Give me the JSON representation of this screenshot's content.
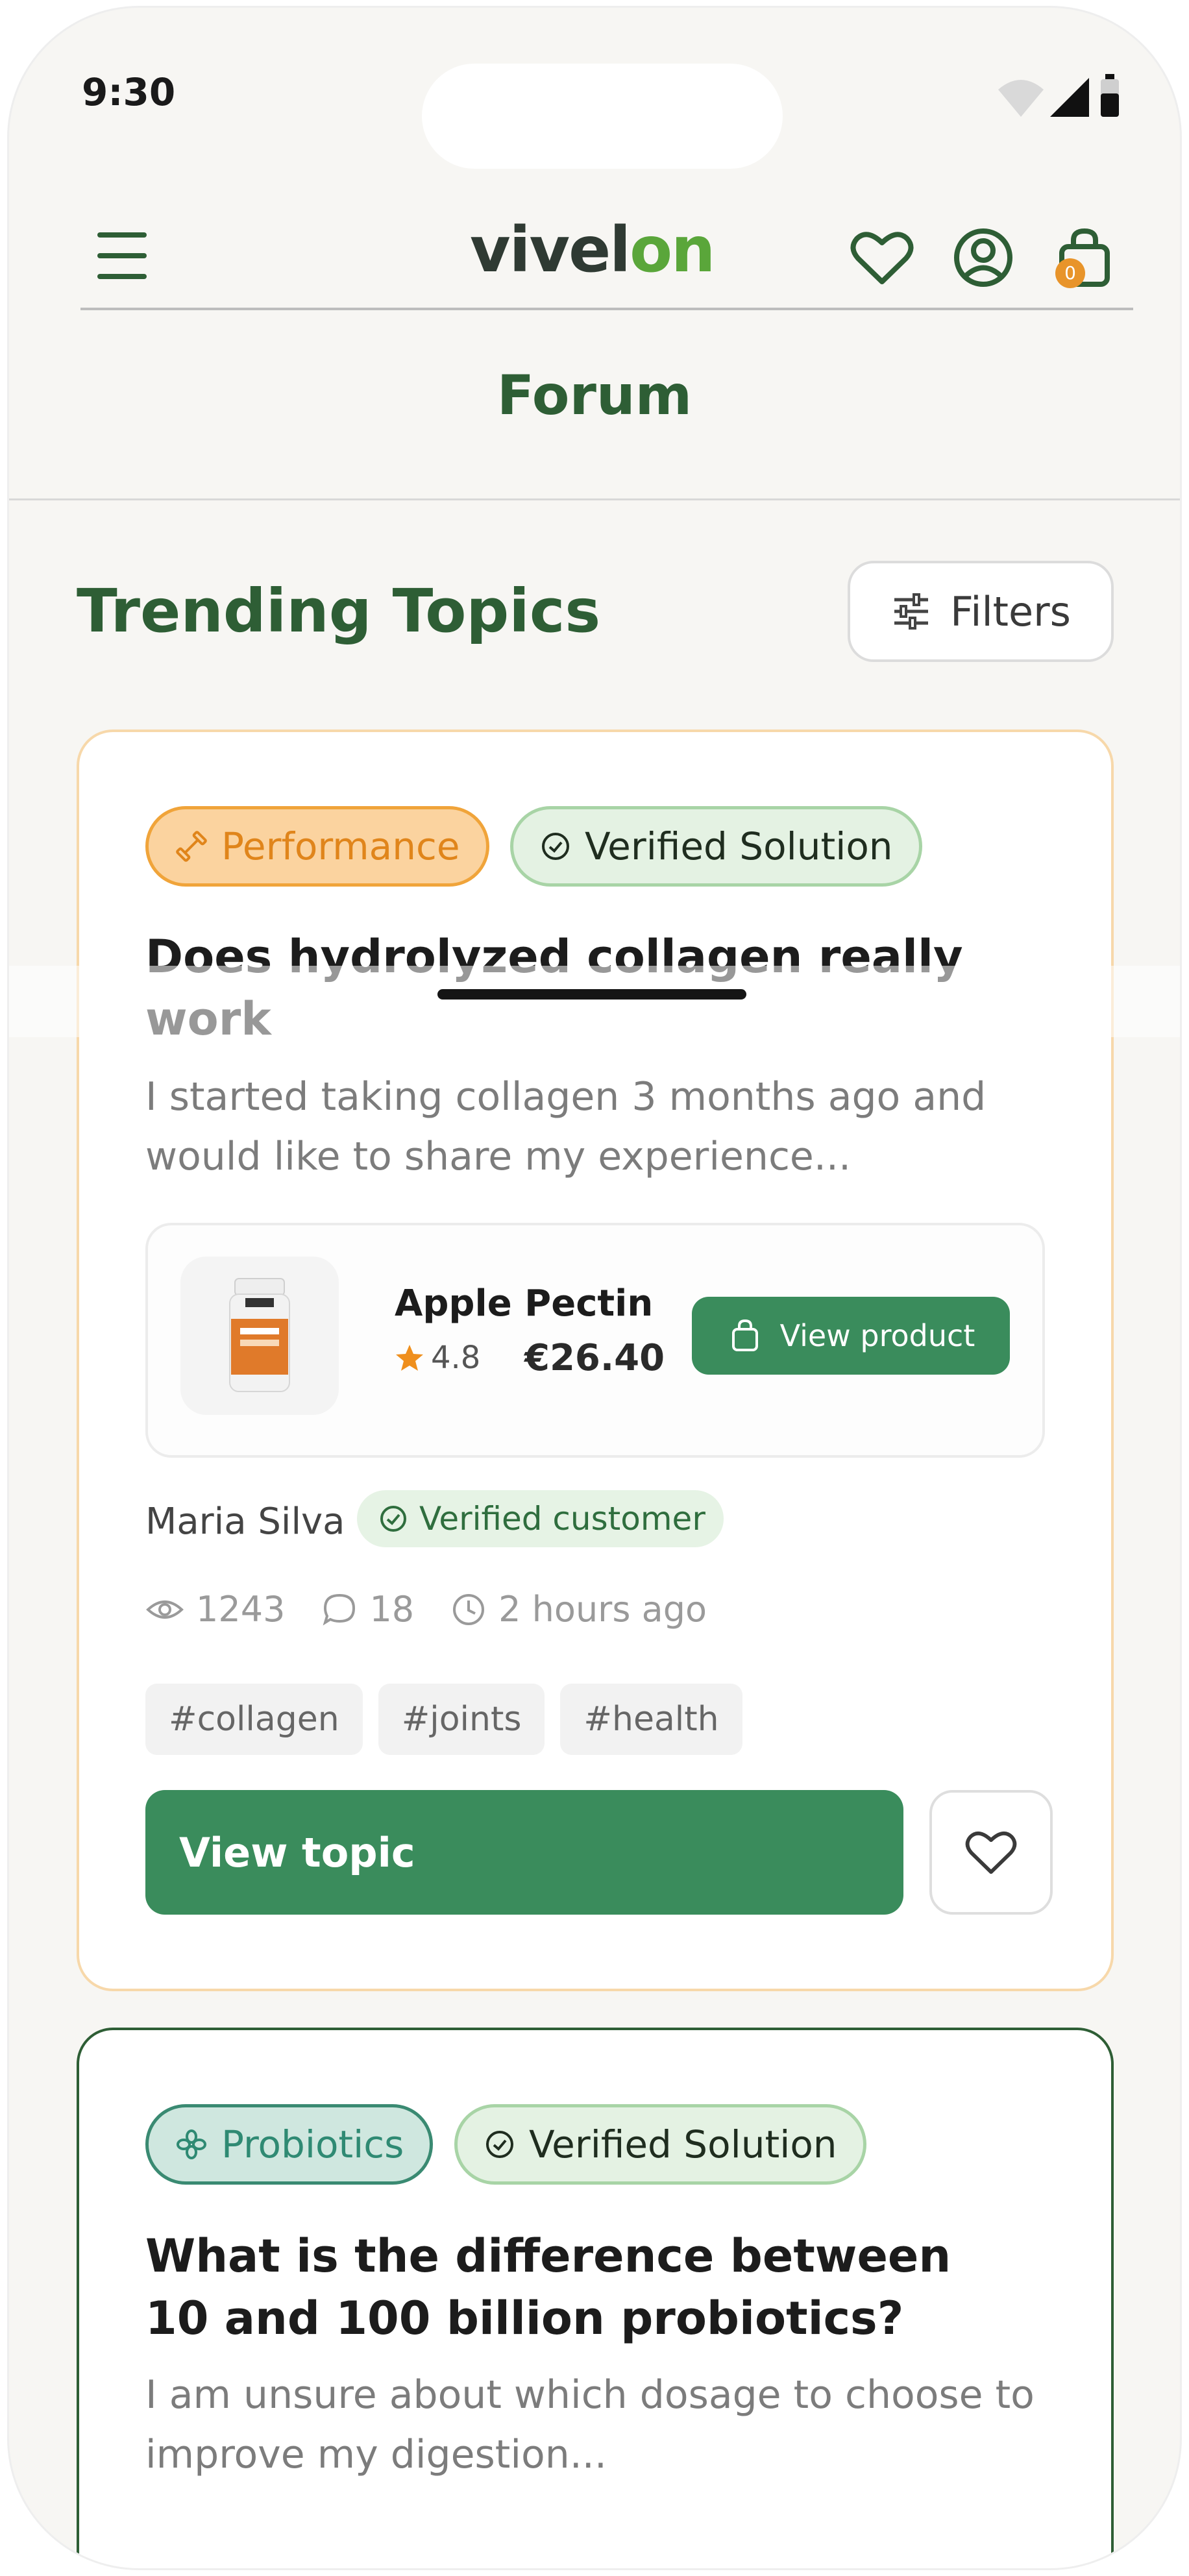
{
  "status_bar": {
    "time": "9:30"
  },
  "header": {
    "logo_text": "vivel",
    "logo_leaf": "o",
    "logo_end": "n",
    "cart_count": "0",
    "icons": [
      "menu-icon",
      "heart-icon",
      "user-icon",
      "cart-icon"
    ]
  },
  "page": {
    "title": "Forum"
  },
  "section": {
    "title": "Trending Topics",
    "filters_label": "Filters"
  },
  "colors": {
    "brand_green": "#2e5e35",
    "button_green": "#3a8c5c",
    "accent_orange": "#e8942a"
  },
  "topics": [
    {
      "category": "Performance",
      "badge": "Verified Solution",
      "title": "Does hydrolyzed collagen really work",
      "excerpt": "I started taking collagen 3 months ago and would like to share my experience...",
      "product": {
        "name": "Apple Pectin",
        "rating": "4.8",
        "price": "€26.40",
        "button": "View product"
      },
      "author": "Maria Silva",
      "author_badge": "Verified customer",
      "views": "1243",
      "comments": "18",
      "time_ago": "2 hours ago",
      "tags": [
        "#collagen",
        "#joints",
        "#health"
      ],
      "cta": "View topic"
    },
    {
      "category": "Probiotics",
      "badge": "Verified Solution",
      "title": "What is the difference between 10 and 100 billion probiotics?",
      "excerpt": "I am unsure about which dosage to choose to improve my digestion..."
    }
  ]
}
